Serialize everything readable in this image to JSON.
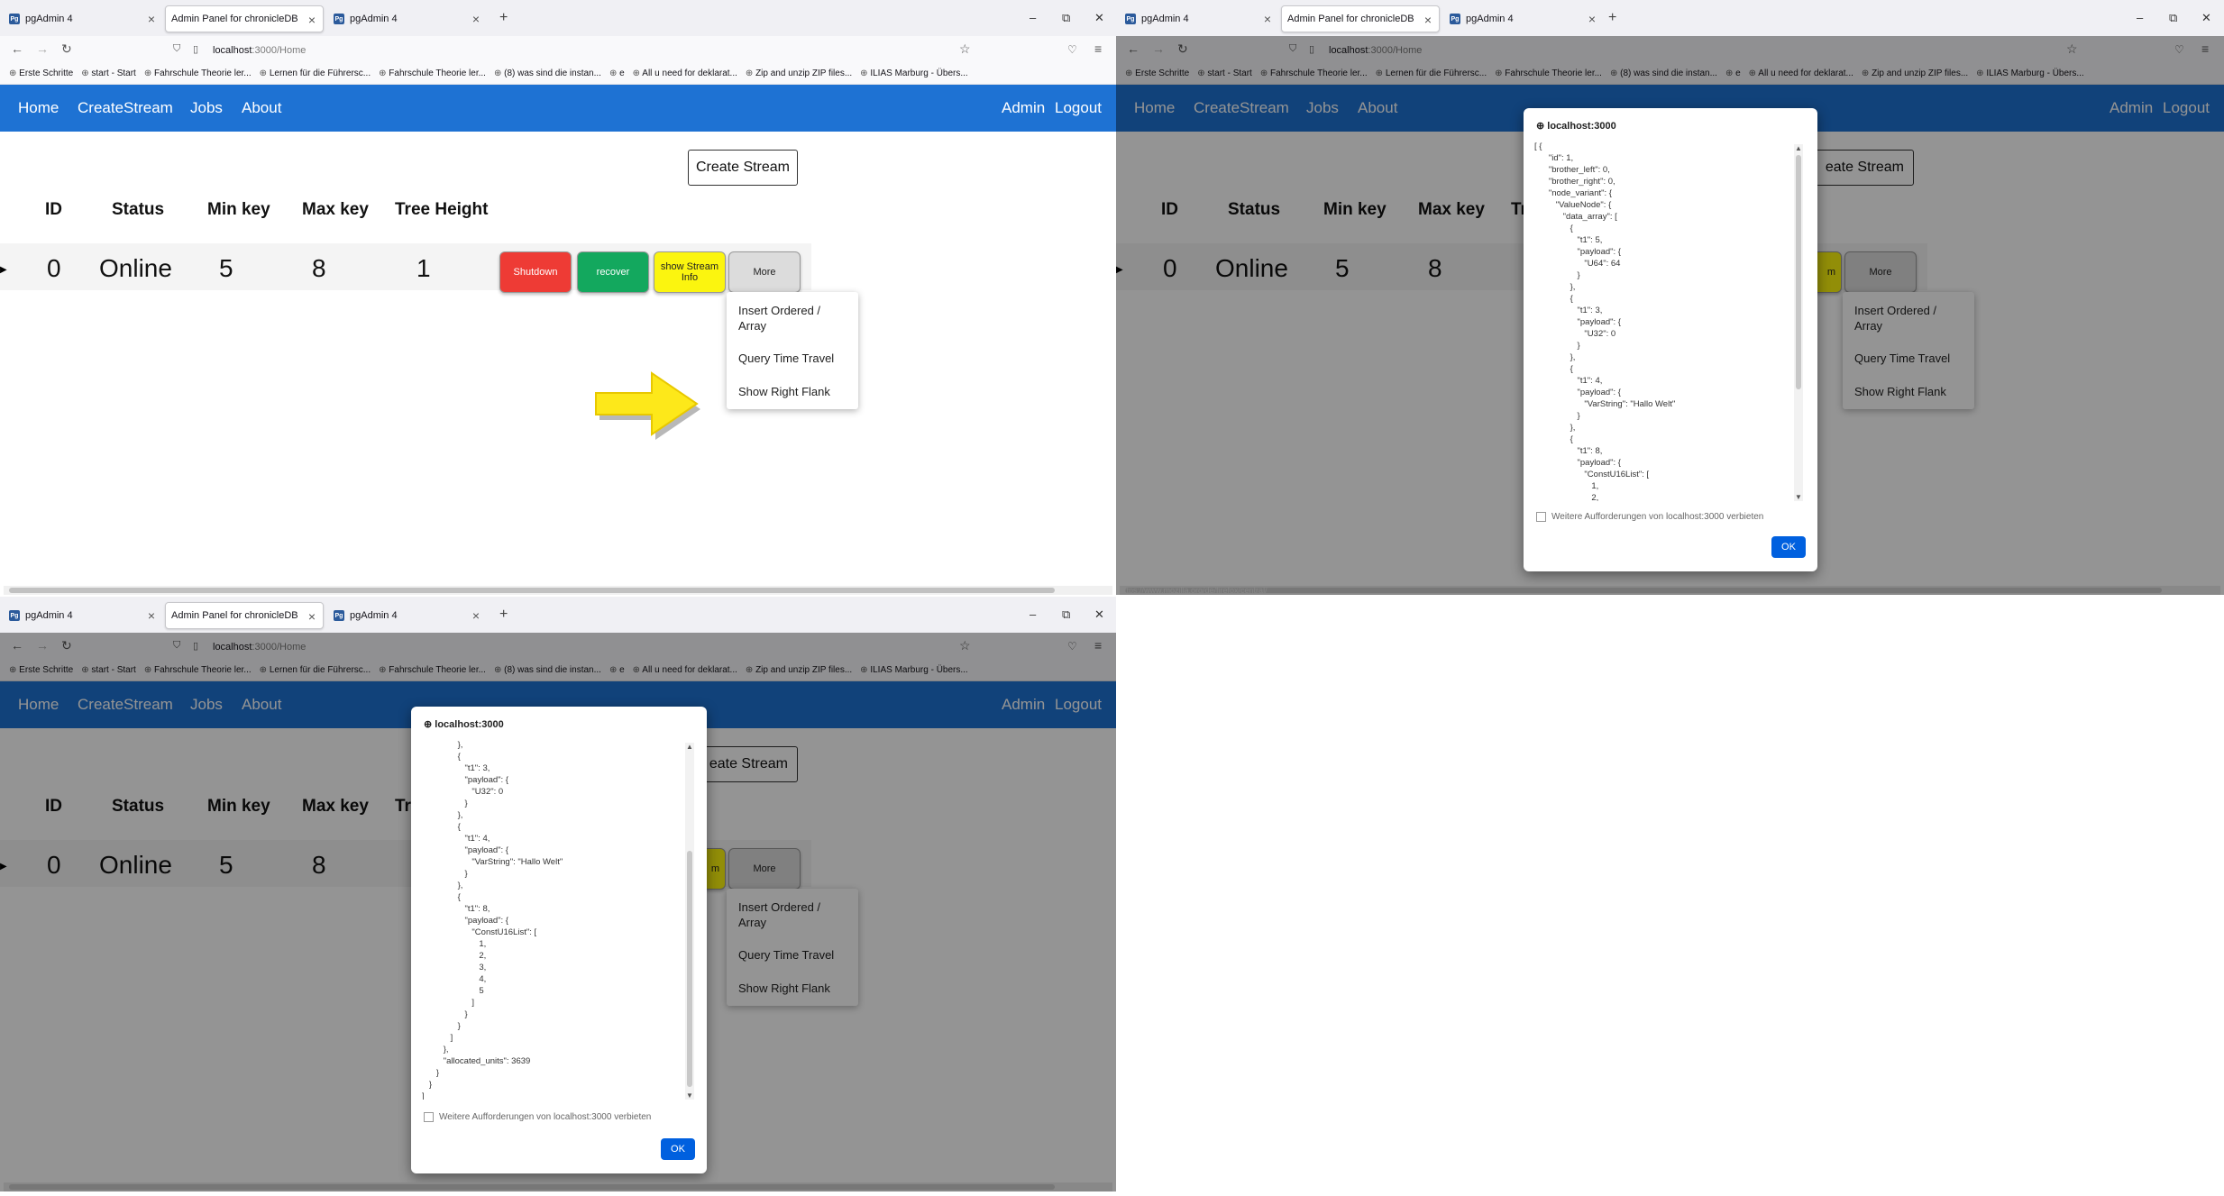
{
  "tabs": [
    {
      "label": "pgAdmin 4"
    },
    {
      "label": "Admin Panel for chronicleDB"
    },
    {
      "label": "pgAdmin 4"
    }
  ],
  "url": {
    "host": "localhost",
    "path": ":3000/Home"
  },
  "bookmarks": [
    "Erste Schritte",
    "start - Start",
    "Fahrschule Theorie ler...",
    "Lernen für die Führersc...",
    "Fahrschule Theorie ler...",
    "(8) was sind die instan...",
    "e",
    "All u need for deklarat...",
    "Zip and unzip ZIP files...",
    "ILIAS Marburg - Übers..."
  ],
  "nav": {
    "home": "Home",
    "create_stream": "CreateStream",
    "jobs": "Jobs",
    "about": "About",
    "admin": "Admin",
    "logout": "Logout"
  },
  "create_stream_button": "Create Stream",
  "create_stream_partial": "eate Stream",
  "table": {
    "headers": {
      "id": "ID",
      "status": "Status",
      "min_key": "Min key",
      "max_key": "Max key",
      "tree_height": "Tree Height",
      "tree_partial": "Tr"
    },
    "row": {
      "id": "0",
      "status": "Online",
      "min_key": "5",
      "max_key": "8",
      "tree_height": "1"
    }
  },
  "actions": {
    "shutdown": "Shutdown",
    "recover": "recover",
    "info": "show Stream Info",
    "info_partial": "m",
    "more": "More"
  },
  "more_menu": {
    "insert": "Insert Ordered / Array",
    "time_travel": "Query Time Travel",
    "right_flank": "Show Right Flank"
  },
  "dialog": {
    "title": "localhost:3000",
    "json_top": "[ {\n      \"id\": 1,\n      \"brother_left\": 0,\n      \"brother_right\": 0,\n      \"node_variant\": {\n         \"ValueNode\": {\n            \"data_array\": [\n               {\n                  \"t1\": 5,\n                  \"payload\": {\n                     \"U64\": 64\n                  }\n               },\n               {\n                  \"t1\": 3,\n                  \"payload\": {\n                     \"U32\": 0\n                  }\n               },\n               {\n                  \"t1\": 4,\n                  \"payload\": {\n                     \"VarString\": \"Hallo Welt\"\n                  }\n               },\n               {\n                  \"t1\": 8,\n                  \"payload\": {\n                     \"ConstU16List\": [\n                        1,\n                        2,",
    "json_bottom": "               },\n               {\n                  \"t1\": 3,\n                  \"payload\": {\n                     \"U32\": 0\n                  }\n               },\n               {\n                  \"t1\": 4,\n                  \"payload\": {\n                     \"VarString\": \"Hallo Welt\"\n                  }\n               },\n               {\n                  \"t1\": 8,\n                  \"payload\": {\n                     \"ConstU16List\": [\n                        1,\n                        2,\n                        3,\n                        4,\n                        5\n                     ]\n                  }\n               }\n            ]\n         },\n         \"allocated_units\": 3639\n      }\n   }\n]",
    "checkbox": "Weitere Aufforderungen von localhost:3000 verbieten",
    "ok": "OK"
  },
  "status_url": "https://www.mozilla.org/de/firefox/central/"
}
